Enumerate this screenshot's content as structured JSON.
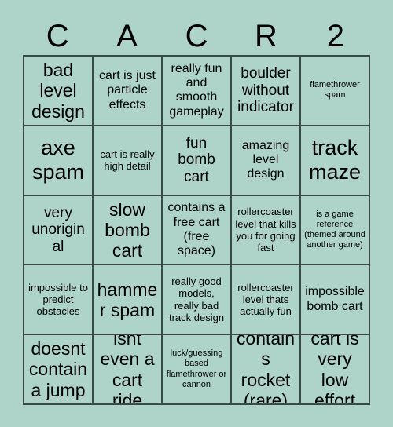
{
  "card": {
    "title_letters": [
      "C",
      "A",
      "C",
      "R",
      "2"
    ],
    "background_color": "#aed4ca",
    "border_color": "#3a4a46",
    "text_color": "#000000",
    "columns": 5,
    "rows": 5,
    "cells": [
      {
        "text": "bad level design",
        "size": "xl"
      },
      {
        "text": "cart is just particle effects",
        "size": "md"
      },
      {
        "text": "really fun and smooth gameplay",
        "size": "md"
      },
      {
        "text": "boulder without indicator",
        "size": "lg"
      },
      {
        "text": "flamethrower spam",
        "size": "xs"
      },
      {
        "text": "axe spam",
        "size": "xxl"
      },
      {
        "text": "cart is really high detail",
        "size": "sm"
      },
      {
        "text": "fun bomb cart",
        "size": "lg"
      },
      {
        "text": "amazing level design",
        "size": "md"
      },
      {
        "text": "track maze",
        "size": "xxl"
      },
      {
        "text": "very unoriginal",
        "size": "lg"
      },
      {
        "text": "slow bomb cart",
        "size": "xl"
      },
      {
        "text": "contains a free cart (free space)",
        "size": "md"
      },
      {
        "text": "rollercoaster level that kills you for going fast",
        "size": "sm"
      },
      {
        "text": "is a game reference (themed around another game)",
        "size": "xs"
      },
      {
        "text": "impossible to predict obstacles",
        "size": "sm"
      },
      {
        "text": "hammer spam",
        "size": "xl"
      },
      {
        "text": "really good models, really bad track design",
        "size": "sm"
      },
      {
        "text": "rollercoaster level thats actually fun",
        "size": "sm"
      },
      {
        "text": "impossible bomb cart",
        "size": "md"
      },
      {
        "text": "doesnt contain a jump",
        "size": "xl"
      },
      {
        "text": "isnt even a cart ride",
        "size": "xl"
      },
      {
        "text": "luck/guessing based flamethrower or cannon",
        "size": "xs"
      },
      {
        "text": "contains rocket (rare)",
        "size": "xl"
      },
      {
        "text": "cart is very low effort",
        "size": "xl"
      }
    ]
  }
}
